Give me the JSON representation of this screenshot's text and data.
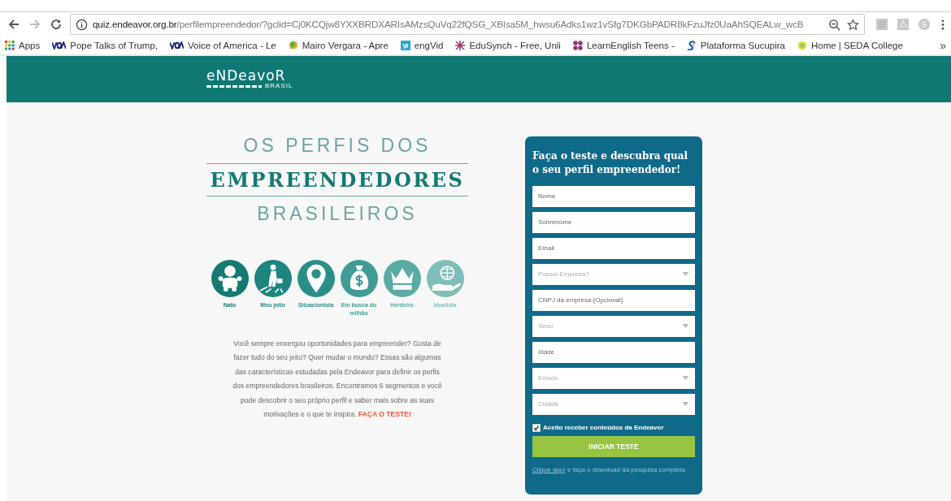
{
  "browser": {
    "url_host": "quiz.endeavor.org.br",
    "url_path": "/perfilempreendedor/?gclid=Cj0KCQjw8YXXBRDXARIsAMzsQuVq22fQSG_XBIsa5M_hwsu6Adks1wz1vSfg7DKGbPADR8kFzuJfz0UaAhSQEALw_wcB",
    "bookmarks": [
      {
        "label": "Apps"
      },
      {
        "label": "Pope Talks of Trump,"
      },
      {
        "label": "Voice of America - Le"
      },
      {
        "label": "Mairo Vergara - Apre"
      },
      {
        "label": "engVid"
      },
      {
        "label": "EduSynch - Free, Unli"
      },
      {
        "label": "LearnEnglish Teens -"
      },
      {
        "label": "Plataforma Sucupira"
      },
      {
        "label": "Home | SEDA College"
      }
    ],
    "more_bookmarks": "»"
  },
  "header": {
    "logo": "eNDeavoR",
    "logo_sub": "BRASIL"
  },
  "hero": {
    "title_top": "OS PERFIS DOS",
    "title_main": "EMPREENDEDORES",
    "title_bottom": "BRASILEIROS"
  },
  "profiles": [
    {
      "label": "Nato",
      "color": "#137a72"
    },
    {
      "label": "Meu jeito",
      "color": "#1e847e"
    },
    {
      "label": "Situacionista",
      "color": "#2a8e87"
    },
    {
      "label": "Em busca do milhão",
      "color": "#3f9b94"
    },
    {
      "label": "Herdeiro",
      "color": "#5aaba5"
    },
    {
      "label": "Idealista",
      "color": "#7fbdb8"
    }
  ],
  "intro": "Você sempre enxergou oportunidades para empreender? Gosta de fazer tudo do seu jeito? Quer mudar o mundo? Essas são algumas das características estudadas pela Endeavor para definir os perfis dos empreendedores brasileiros. Encontramos 6 segmentos e você pode descobrir o seu próprio perfil e saber mais sobre as suas motivações e o que te inspira. **FAÇA O TESTE!**",
  "form": {
    "title": "Faça o teste e descubra qual o seu perfil empreendedor!",
    "fields": [
      {
        "kind": "input",
        "placeholder": "Nome"
      },
      {
        "kind": "input",
        "placeholder": "Sobrenome"
      },
      {
        "kind": "input",
        "placeholder": "Email"
      },
      {
        "kind": "select",
        "placeholder": "Possui Empresa?"
      },
      {
        "kind": "input",
        "placeholder": "CNPJ da empresa (Opcional)"
      },
      {
        "kind": "select",
        "placeholder": "Sexo"
      },
      {
        "kind": "input",
        "placeholder": "Idade"
      },
      {
        "kind": "select",
        "placeholder": "Estado"
      },
      {
        "kind": "select",
        "placeholder": "Cidade"
      }
    ],
    "consent": {
      "label": "Aceito receber conteúdos da Endeavor",
      "checked": true
    },
    "submit": "INICIAR TESTE",
    "download_link": "Clique aqui",
    "download_text": "e faça o download da pesquisa completa"
  }
}
